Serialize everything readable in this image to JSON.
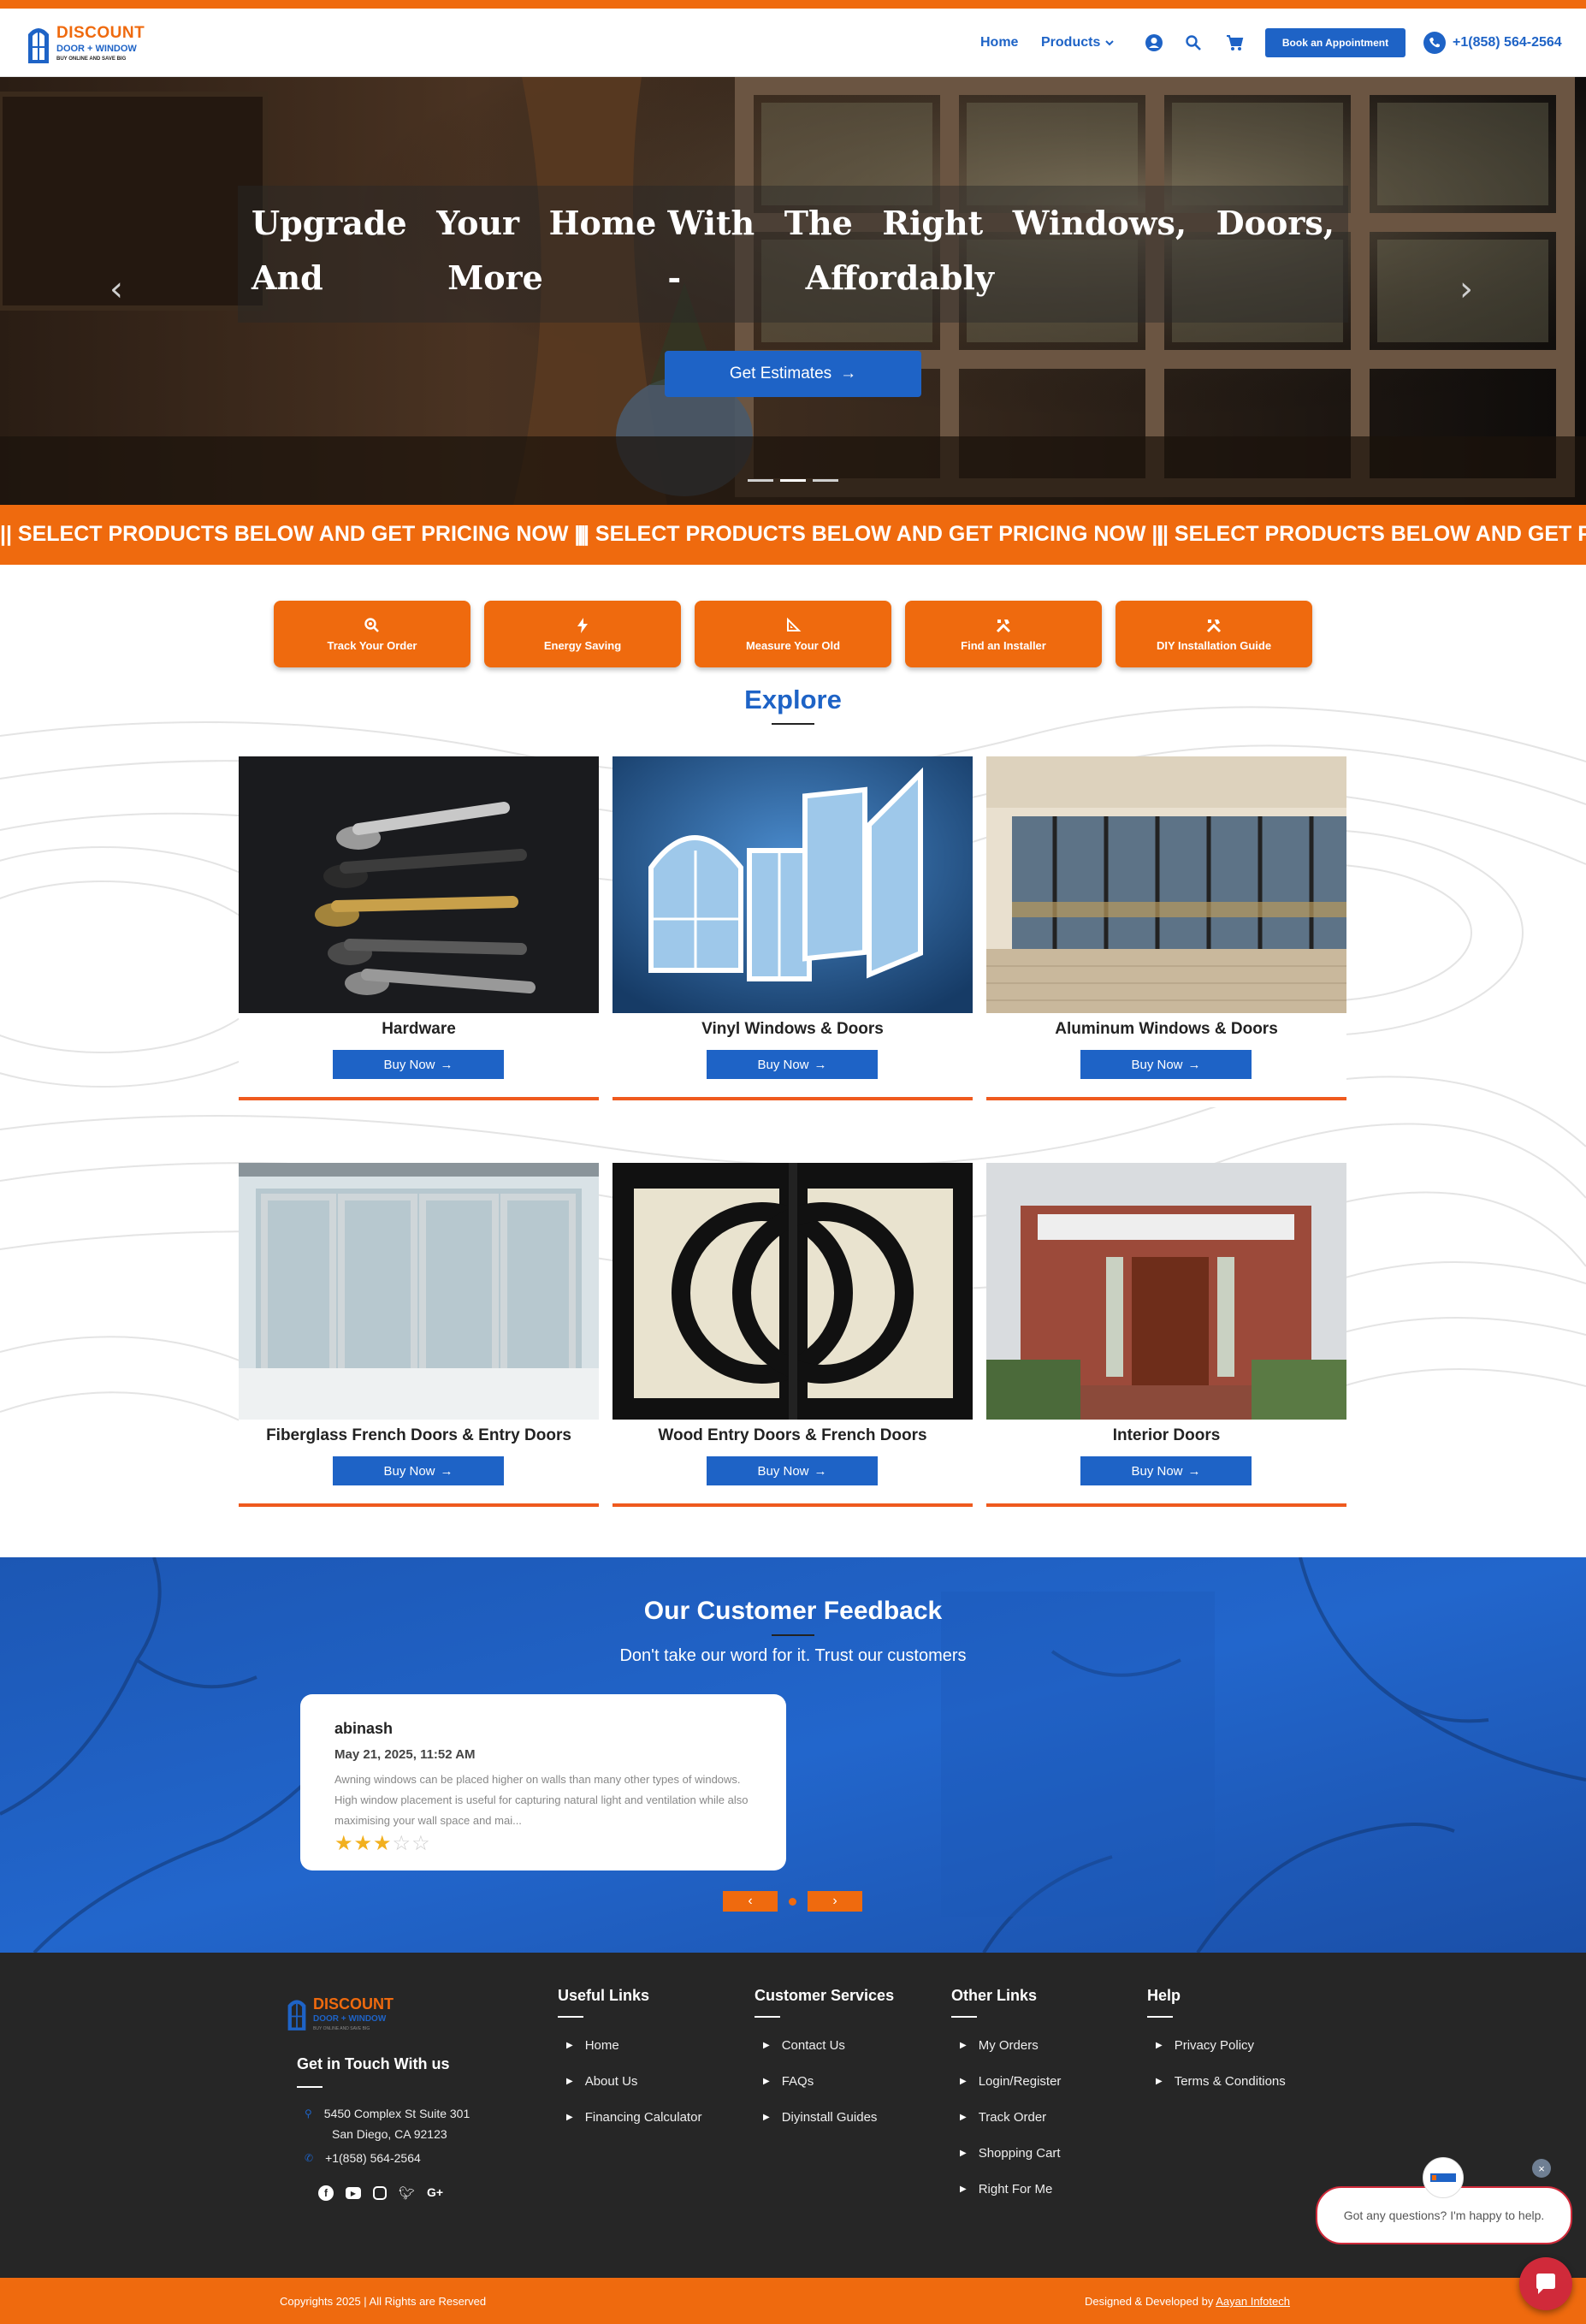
{
  "header": {
    "logo": {
      "line1": "DISCOUNT",
      "line2": "DOOR + WINDOW",
      "tagline": "BUY ONLINE AND SAVE BIG"
    },
    "nav": [
      {
        "label": "Home"
      },
      {
        "label": "Products"
      }
    ],
    "book_button": "Book an Appointment",
    "phone": "+1(858) 564-2564"
  },
  "hero": {
    "line1": [
      "Upgrade",
      "Your",
      "Home With",
      "The",
      "Right",
      "Windows,",
      "Doors,"
    ],
    "line2": [
      "And",
      "More",
      "-",
      "Affordably"
    ],
    "cta": "Get Estimates",
    "slides": 3,
    "active_slide": 2
  },
  "ticker": {
    "text": "|| SELECT PRODUCTS BELOW AND GET PRICING NOW ||"
  },
  "quick_links": [
    {
      "label": "Track Your Order",
      "icon": "track-search-icon"
    },
    {
      "label": "Energy Saving",
      "icon": "lightning-icon"
    },
    {
      "label": "Measure Your Old",
      "icon": "ruler-triangle-icon"
    },
    {
      "label": "Find an Installer",
      "icon": "tools-icon"
    },
    {
      "label": "DIY Installation Guide",
      "icon": "tools-icon"
    }
  ],
  "explore": {
    "title": "Explore",
    "cards": [
      {
        "title": "Hardware",
        "button": "Buy Now"
      },
      {
        "title": "Vinyl Windows & Doors",
        "button": "Buy Now"
      },
      {
        "title": "Aluminum Windows & Doors",
        "button": "Buy Now"
      },
      {
        "title": "Fiberglass French Doors & Entry Doors",
        "button": "Buy Now"
      },
      {
        "title": "Wood Entry Doors & French Doors",
        "button": "Buy Now"
      },
      {
        "title": "Interior Doors",
        "button": "Buy Now"
      }
    ]
  },
  "feedback": {
    "title": "Our Customer Feedback",
    "subtitle": "Don't take our word for it. Trust our customers",
    "review": {
      "name": "abinash",
      "date": "May 21, 2025, 11:52 AM",
      "text": "Awning windows can be placed higher on walls than many other types of windows. High window placement is useful for capturing natural light and ventilation while also maximising your wall space and mai...",
      "rating": 3,
      "max_rating": 5
    }
  },
  "footer": {
    "contact": {
      "title": "Get in Touch With us",
      "address1": "5450 Complex St Suite 301",
      "address2": "San Diego, CA 92123",
      "phone": "+1(858) 564-2564"
    },
    "columns": [
      {
        "title": "Useful Links",
        "links": [
          "Home",
          "About Us",
          "Financing Calculator"
        ]
      },
      {
        "title": "Customer Services",
        "links": [
          "Contact Us",
          "FAQs",
          "Diyinstall Guides"
        ]
      },
      {
        "title": "Other Links",
        "links": [
          "My Orders",
          "Login/Register",
          "Track Order",
          "Shopping Cart",
          "Right For Me"
        ]
      },
      {
        "title": "Help",
        "links": [
          "Privacy Policy",
          "Terms & Conditions"
        ]
      }
    ],
    "copyright": "Copyrights 2025 | All Rights are Reserved",
    "credit_prefix": "Designed & Developed by",
    "credit_link": "Aayan Infotech"
  },
  "chat": {
    "message": "Got any questions? I'm happy to help."
  },
  "colors": {
    "brand_orange": "#ef6a0e",
    "brand_blue": "#1e63c6",
    "footer_bg": "#262626"
  }
}
